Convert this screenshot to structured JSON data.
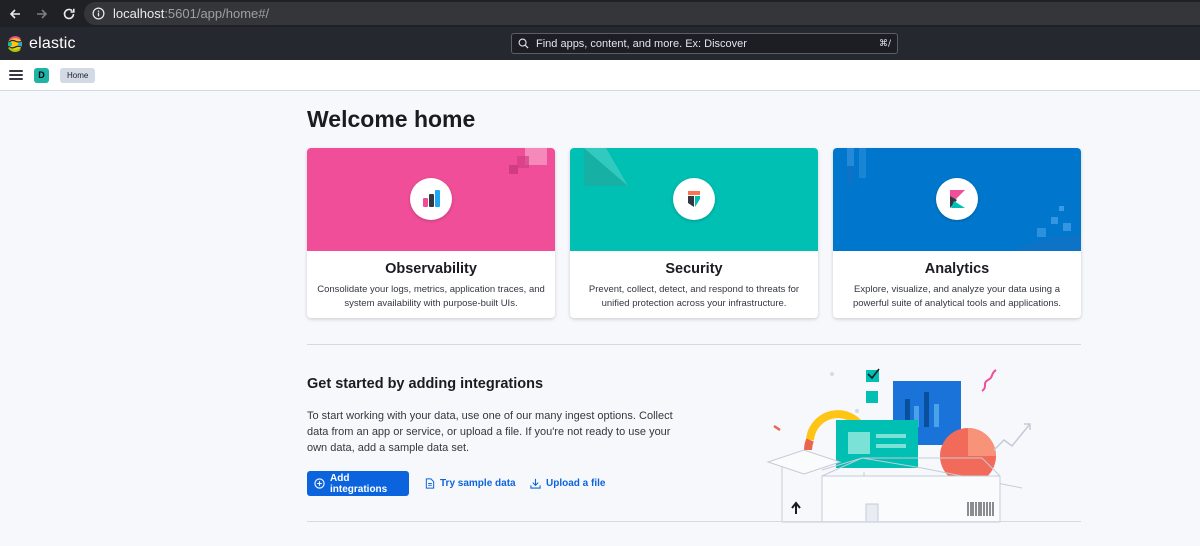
{
  "browser": {
    "url_host": "localhost",
    "url_path": ":5601/app/home#/"
  },
  "header": {
    "logo_text": "elastic",
    "search_placeholder": "Find apps, content, and more. Ex: Discover",
    "search_shortcut": "⌘/"
  },
  "subheader": {
    "space_initial": "D",
    "breadcrumb": "Home"
  },
  "main": {
    "title": "Welcome home",
    "cards": [
      {
        "title": "Observability",
        "description": "Consolidate your logs, metrics, application traces, and system availability with purpose-built UIs.",
        "color": "#f04e98"
      },
      {
        "title": "Security",
        "description": "Prevent, collect, detect, and respond to threats for unified protection across your infrastructure.",
        "color": "#00bfb3"
      },
      {
        "title": "Analytics",
        "description": "Explore, visualize, and analyze your data using a powerful suite of analytical tools and applications.",
        "color": "#0077cc"
      }
    ],
    "integrations": {
      "title": "Get started by adding integrations",
      "body": "To start working with your data, use one of our many ingest options. Collect data from an app or service, or upload a file. If you're not ready to use your own data, add a sample data set.",
      "add_button": "Add integrations",
      "sample_link": "Try sample data",
      "upload_link": "Upload a file"
    }
  },
  "colors": {
    "primary": "#0b64dd",
    "header_dark": "#25282f",
    "page_bg": "#f7f8fc"
  }
}
